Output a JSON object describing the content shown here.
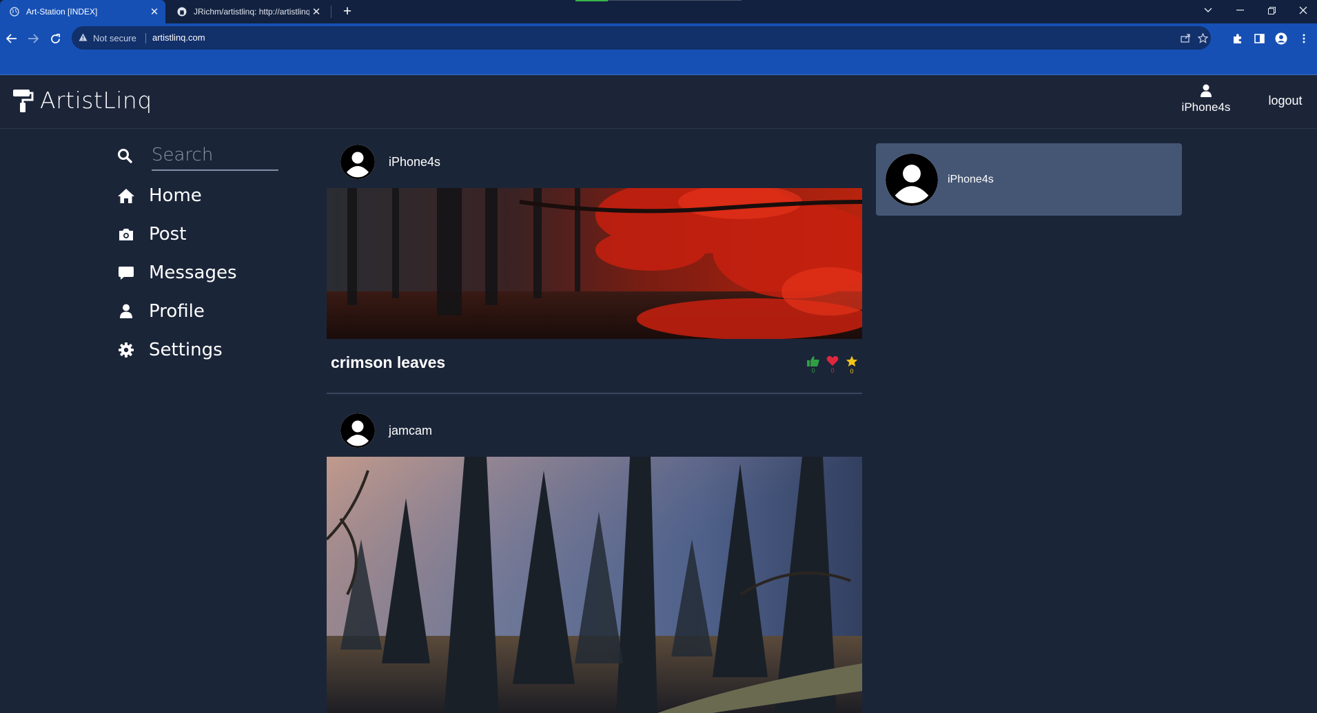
{
  "browser": {
    "tabs": [
      {
        "title": "Art-Station [INDEX]",
        "active": true
      },
      {
        "title": "JRichm/artistlinq: http://artistlinq",
        "active": false
      }
    ],
    "security_label": "Not secure",
    "url": "artistlinq.com"
  },
  "site": {
    "brand": "ArtistLinq",
    "header_user": "iPhone4s",
    "logout_label": "logout"
  },
  "sidebar": {
    "search_placeholder": "Search",
    "items": [
      {
        "label": "Home",
        "icon": "home-icon"
      },
      {
        "label": "Post",
        "icon": "camera-icon"
      },
      {
        "label": "Messages",
        "icon": "message-icon"
      },
      {
        "label": "Profile",
        "icon": "user-icon"
      },
      {
        "label": "Settings",
        "icon": "gear-icon"
      }
    ]
  },
  "feed": {
    "posts": [
      {
        "author": "iPhone4s",
        "title": "crimson leaves",
        "image": "red-autumn-forest",
        "likes": "0",
        "hearts": "0",
        "stars": "0"
      },
      {
        "author": "jamcam",
        "image": "misty-pine-forest"
      }
    ]
  },
  "right_panel": {
    "username": "iPhone4s"
  },
  "colors": {
    "background": "#1b2538",
    "card": "#455675",
    "chrome_blue": "#1650b5",
    "like_green": "#2ea043",
    "heart_red": "#e0263c",
    "star_yellow": "#f5c518"
  }
}
